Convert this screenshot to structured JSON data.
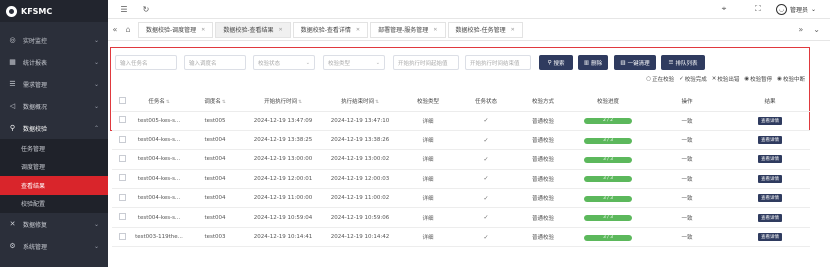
{
  "brand": {
    "name": "KFSMC"
  },
  "sidebar": {
    "items": [
      {
        "label": "实时监控",
        "icon": "monitor-icon",
        "glyph": "◎"
      },
      {
        "label": "统计报表",
        "icon": "report-icon",
        "glyph": "▦"
      },
      {
        "label": "需求管理",
        "icon": "demand-icon",
        "glyph": "☰"
      },
      {
        "label": "数据概况",
        "icon": "overview-icon",
        "glyph": "◁"
      },
      {
        "label": "数据校验",
        "icon": "verify-icon",
        "glyph": "⚲"
      }
    ],
    "subitems": [
      {
        "label": "任务管理"
      },
      {
        "label": "调度管理"
      },
      {
        "label": "查看结果"
      },
      {
        "label": "校验配置"
      }
    ],
    "items_after": [
      {
        "label": "数据修复",
        "icon": "repair-icon",
        "glyph": "✕"
      },
      {
        "label": "系统管理",
        "icon": "system-icon",
        "glyph": "⚙"
      }
    ]
  },
  "topbar": {
    "username": "管理员"
  },
  "tabs": [
    {
      "label": "数据校验-调度管理"
    },
    {
      "label": "数据校验-查看结果"
    },
    {
      "label": "数据校验-查看详情"
    },
    {
      "label": "部署管理-服务管理"
    },
    {
      "label": "数据校验-任务管理"
    }
  ],
  "filters": {
    "task_name_placeholder": "输入任务名",
    "schedule_name_placeholder": "输入调度名",
    "status_placeholder": "校验状态",
    "type_placeholder": "校验类型",
    "start_time_placeholder": "开始执行时间起始值",
    "end_time_placeholder": "开始执行时间结束值",
    "search_label": "搜索",
    "delete_label": "删除",
    "clear_label": "一键清理",
    "queue_label": "排队列表"
  },
  "legend": [
    "正在校验",
    "校验完成",
    "校验出错",
    "校验暂停",
    "校验中断"
  ],
  "table": {
    "headers": [
      "任务名",
      "调度名",
      "开始执行时间",
      "执行结束时间",
      "校验类型",
      "任务状态",
      "校验方式",
      "校验进度",
      "操作",
      "结果"
    ],
    "rows": [
      {
        "task": "test005-kes-s...",
        "schedule": "test005",
        "start": "2024-12-19 13:47:09",
        "end": "2024-12-19 13:47:10",
        "type": "详细",
        "method": "普通校验",
        "progress": "2 / 2",
        "op": "一致",
        "result": "查看详情"
      },
      {
        "task": "test004-kes-s...",
        "schedule": "test004",
        "start": "2024-12-19 13:38:25",
        "end": "2024-12-19 13:38:26",
        "type": "详细",
        "method": "普通校验",
        "progress": "3 / 3",
        "op": "一致",
        "result": "查看详情"
      },
      {
        "task": "test004-kes-s...",
        "schedule": "test004",
        "start": "2024-12-19 13:00:00",
        "end": "2024-12-19 13:00:02",
        "type": "详细",
        "method": "普通校验",
        "progress": "3 / 3",
        "op": "一致",
        "result": "查看详情"
      },
      {
        "task": "test004-kes-s...",
        "schedule": "test004",
        "start": "2024-12-19 12:00:01",
        "end": "2024-12-19 12:00:03",
        "type": "详细",
        "method": "普通校验",
        "progress": "3 / 3",
        "op": "一致",
        "result": "查看详情"
      },
      {
        "task": "test004-kes-s...",
        "schedule": "test004",
        "start": "2024-12-19 11:00:00",
        "end": "2024-12-19 11:00:02",
        "type": "详细",
        "method": "普通校验",
        "progress": "3 / 3",
        "op": "一致",
        "result": "查看详情"
      },
      {
        "task": "test004-kes-s...",
        "schedule": "test004",
        "start": "2024-12-19 10:59:04",
        "end": "2024-12-19 10:59:06",
        "type": "详细",
        "method": "普通校验",
        "progress": "3 / 3",
        "op": "一致",
        "result": "查看详情"
      },
      {
        "task": "test003-119the...",
        "schedule": "test003",
        "start": "2024-12-19 10:14:41",
        "end": "2024-12-19 10:14:42",
        "type": "详细",
        "method": "普通校验",
        "progress": "3 / 3",
        "op": "一致",
        "result": "查看详情"
      }
    ]
  },
  "colors": {
    "accent": "#d9252b",
    "sidebar_bg": "#2b2f3a",
    "button_bg": "#2f3b5f",
    "progress_bg": "#5cb85c"
  }
}
